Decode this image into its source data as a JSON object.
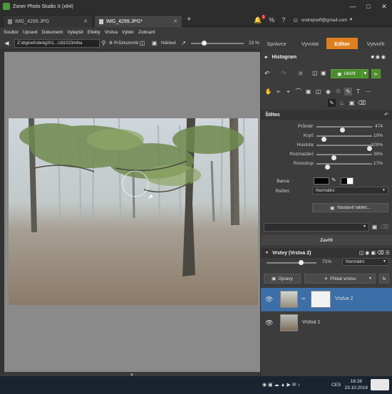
{
  "window": {
    "title": "Zoner Photo Studio X (x64)"
  },
  "tabs": [
    {
      "label": "IMG_4299.JPG"
    },
    {
      "label": "IMG_4299.JPG*"
    }
  ],
  "account": {
    "email": "ondrejneff@gmail.com",
    "notif_count": "1"
  },
  "menu": [
    "Soubor",
    "Upravit",
    "Dokument",
    "Vylepšit",
    "Efekty",
    "Vrstva",
    "Výběr",
    "Zobrazit"
  ],
  "modes": {
    "manager": "Správce",
    "develop": "Vyvolat",
    "editor": "Editor",
    "create": "Vytvořit"
  },
  "addressbar": {
    "path": "Z:\\diginef\\obrdg201...\\181023mlha",
    "explorer_label": "Průzkumník",
    "preview_label": "Náhled",
    "zoom": "23 %",
    "zoom_level": 0.23
  },
  "histogram": {
    "label": "Histogram"
  },
  "save": {
    "label": "Uložit"
  },
  "brush": {
    "title": "Štětec",
    "sliders": [
      {
        "label": "Průměr:",
        "value": "474",
        "level": 0.47
      },
      {
        "label": "Krytí:",
        "value": "10%",
        "level": 0.1
      },
      {
        "label": "Hustota:",
        "value": "100%",
        "level": 1.0
      },
      {
        "label": "Rozmazání:",
        "value": "30%",
        "level": 0.3
      },
      {
        "label": "Rozestup:",
        "value": "17%",
        "level": 0.17
      }
    ],
    "color_label": "Barva:",
    "mode_label": "Režim:",
    "mode_value": "Normální",
    "tablet_button": "Nastavit tablet...",
    "close_button": "Zavřít"
  },
  "layers": {
    "title": "Vrstvy (Vrstva 2)",
    "opacity": "71%",
    "opacity_level": 0.71,
    "blend": "Normální",
    "adjust_label": "Úpravy",
    "add_label": "Přidat vrstvu",
    "fx_label": "fx",
    "items": [
      {
        "name": "Vrstva 2"
      },
      {
        "name": "Vrstva 1"
      }
    ]
  },
  "taskbar": {
    "time": "18:28",
    "date": "23.10.2018",
    "lang": "CES"
  },
  "colors": {
    "accent": "#e07f1f",
    "selected_layer": "#3c6fa8",
    "save_green": "#4b8d2c"
  }
}
